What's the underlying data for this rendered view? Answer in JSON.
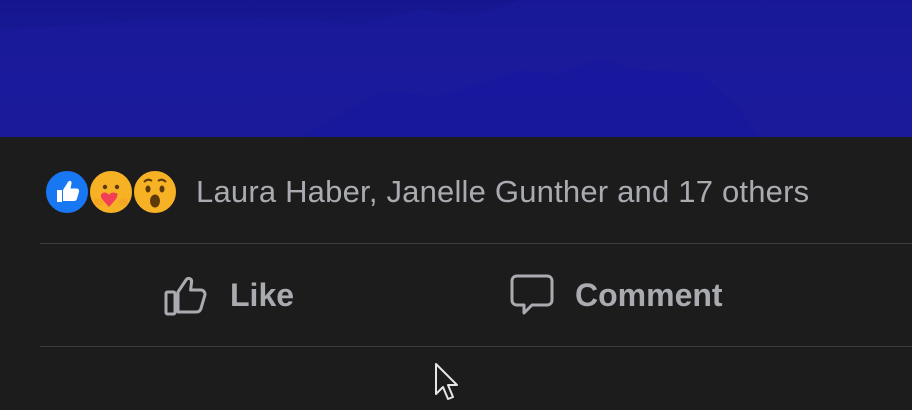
{
  "post": {
    "image_icon": "landscape-photo"
  },
  "reactions": {
    "icons": [
      "like-icon",
      "care-icon",
      "wow-icon"
    ],
    "summary_text": "Laura Haber, Janelle Gunther and 17 others"
  },
  "actions": {
    "like_label": "Like",
    "comment_label": "Comment"
  },
  "colors": {
    "background": "#1c1c1d",
    "text_muted": "#a9abb0",
    "divider": "#3d3c3c",
    "like_blue": "#1877f2",
    "image_blue": "#1a1b9a"
  }
}
